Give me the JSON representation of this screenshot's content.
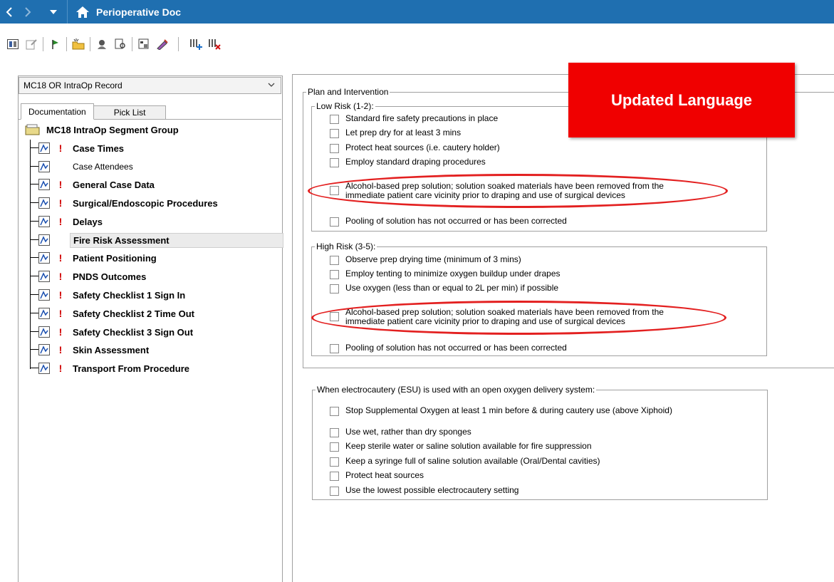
{
  "titlebar": {
    "title": "Perioperative Doc",
    "back_icon": "chevron-left-icon",
    "forward_icon": "chevron-right-icon",
    "menu_icon": "dropdown-arrow-icon",
    "home_icon": "home-icon"
  },
  "toolbar": {
    "icons": [
      "form-view-icon",
      "edit-icon",
      "flag-icon",
      "new-folder-icon",
      "person-icon",
      "review-icon",
      "properties-icon",
      "sign-icon",
      "add-columns-icon",
      "remove-columns-icon"
    ]
  },
  "left_panel": {
    "select_value": "MC18 OR IntraOp Record",
    "tabs": {
      "documentation": "Documentation",
      "pick_list": "Pick List"
    },
    "tree_root": "MC18 IntraOp Segment Group",
    "items": [
      {
        "label": "Case Times",
        "required": "!"
      },
      {
        "label": "Case Attendees",
        "required": ""
      },
      {
        "label": "General Case Data",
        "required": "!"
      },
      {
        "label": "Surgical/Endoscopic Procedures",
        "required": "!"
      },
      {
        "label": "Delays",
        "required": "!"
      },
      {
        "label": "Fire Risk Assessment",
        "required": ""
      },
      {
        "label": "Patient Positioning",
        "required": "!"
      },
      {
        "label": "PNDS Outcomes",
        "required": "!"
      },
      {
        "label": "Safety Checklist 1 Sign In",
        "required": "!"
      },
      {
        "label": "Safety Checklist 2 Time Out",
        "required": "!"
      },
      {
        "label": "Safety Checklist 3 Sign Out",
        "required": "!"
      },
      {
        "label": "Skin Assessment",
        "required": "!"
      },
      {
        "label": "Transport From Procedure",
        "required": "!"
      }
    ]
  },
  "form": {
    "plan_legend": "Plan and Intervention",
    "low_risk": {
      "legend": "Low Risk (1-2):",
      "items": [
        "Standard fire safety precautions in place",
        "Let prep dry for at least 3 mins",
        "Protect heat sources (i.e. cautery holder)",
        "Employ standard draping procedures",
        "Alcohol-based prep solution; solution soaked materials have been removed from the",
        "immediate patient care vicinity prior to draping and use of surgical devices",
        "Pooling of solution has not occurred or has been corrected"
      ]
    },
    "high_risk": {
      "legend": "High Risk (3-5):",
      "items": [
        "Observe prep drying time (minimum of 3 mins)",
        "Employ tenting to minimize oxygen buildup under drapes",
        "Use oxygen (less than or equal to 2L per min) if possible",
        "Alcohol-based prep solution; solution soaked materials have been removed from the",
        "immediate patient care vicinity prior to draping and use of surgical devices",
        "Pooling of solution has not occurred or has been corrected"
      ]
    },
    "esu": {
      "legend": "When electrocautery (ESU) is used with an open oxygen delivery system:",
      "items": [
        "Stop Supplemental Oxygen at least 1 min before & during cautery use (above Xiphoid)",
        "Use wet, rather than dry sponges",
        "Keep sterile water or saline solution available for fire suppression",
        "Keep a syringe full of saline solution available (Oral/Dental cavities)",
        "Protect heat sources",
        "Use the lowest possible electrocautery setting"
      ]
    }
  },
  "banner": {
    "text": "Updated Language",
    "color": "#f00000"
  },
  "colors": {
    "titlebar": "#1f6fb0",
    "required": "#d00000",
    "highlight_oval": "#e32020"
  }
}
